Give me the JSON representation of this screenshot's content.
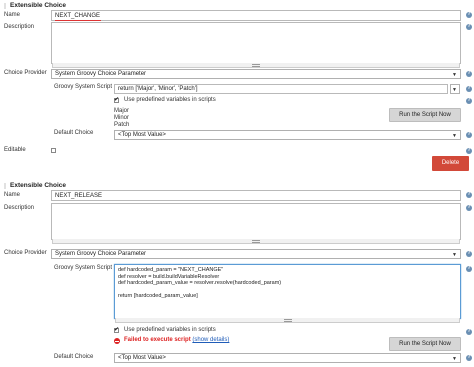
{
  "block1": {
    "header": "Extensible Choice",
    "name_label": "Name",
    "name_value": "NEXT_CHANGE",
    "description_label": "Description",
    "choice_provider_label": "Choice Provider",
    "choice_provider_value": "System Groovy Choice Parameter",
    "groovy_label": "Groovy System Script",
    "groovy_value": "return ['Major', 'Minor', 'Patch']",
    "predefined_label": "Use predefined variables in scripts",
    "result_lines": [
      "Major",
      "Minor",
      "Patch"
    ],
    "run_button": "Run the Script Now",
    "default_choice_label": "Default Choice",
    "default_choice_value": "<Top Most Value>",
    "editable_label": "Editable",
    "delete_button": "Delete"
  },
  "block2": {
    "header": "Extensible Choice",
    "name_label": "Name",
    "name_value": "NEXT_RELEASE",
    "description_label": "Description",
    "choice_provider_label": "Choice Provider",
    "choice_provider_value": "System Groovy Choice Parameter",
    "groovy_label": "Groovy System Script",
    "script_lines": [
      "def hardcoded_param = \"NEXT_CHANGE\"",
      "def resolver = build.buildVariableResolver",
      "def hardcoded_param_value = resolver.resolve(hardcoded_param)",
      "",
      "return [hardcoded_param_value]"
    ],
    "predefined_label": "Use predefined variables in scripts",
    "error_text": "Failed to execute script",
    "error_link": "(show details)",
    "run_button": "Run the Script Now",
    "default_choice_label": "Default Choice",
    "default_choice_value": "<Top Most Value>"
  },
  "colors": {
    "delete_red": "#d24939",
    "error_red": "#d22222",
    "link_blue": "#1f5cb8"
  }
}
